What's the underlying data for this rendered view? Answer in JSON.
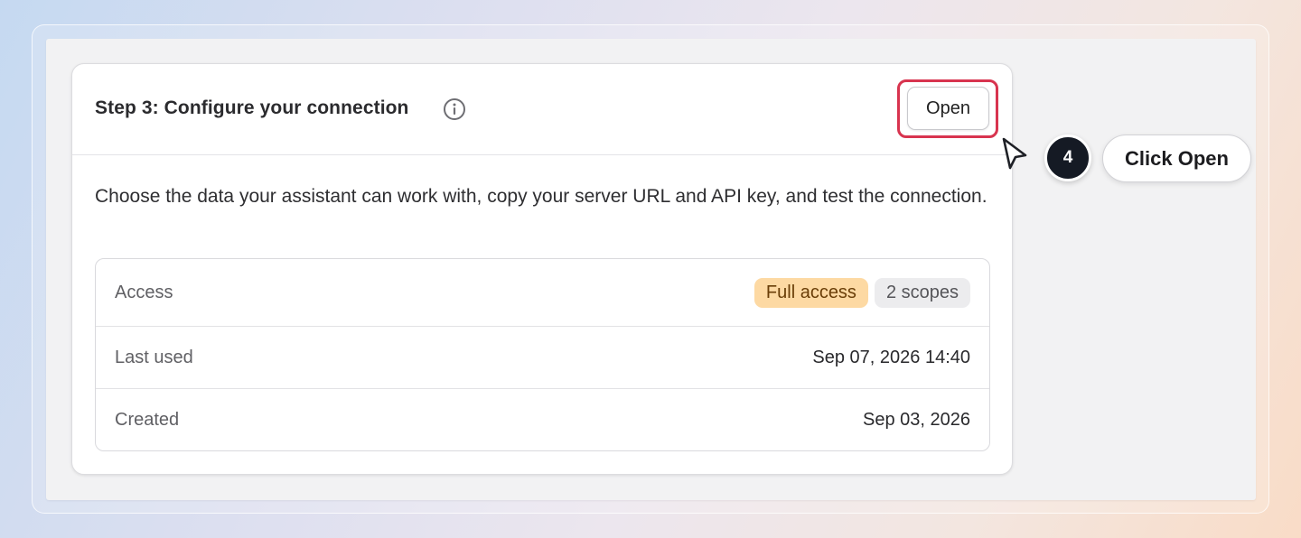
{
  "card": {
    "title": "Step 3: Configure your connection",
    "open_button_label": "Open",
    "description": "Choose the data your assistant can work with, copy your server URL and API key, and test the connection."
  },
  "details": {
    "access": {
      "label": "Access",
      "badges": [
        "Full access",
        "2 scopes"
      ]
    },
    "last_used": {
      "label": "Last used",
      "value": "Sep 07, 2026 14:40"
    },
    "created": {
      "label": "Created",
      "value": "Sep 03, 2026"
    }
  },
  "annotation": {
    "step_number": "4",
    "instruction": "Click Open"
  },
  "icons": {
    "info": "info-circle-icon",
    "cursor": "mouse-pointer-icon"
  },
  "colors": {
    "highlight": "#d8344f",
    "badge_full_bg": "#fdd9a3",
    "badge_scopes_bg": "#ececee",
    "step_badge_bg": "#151a24"
  }
}
